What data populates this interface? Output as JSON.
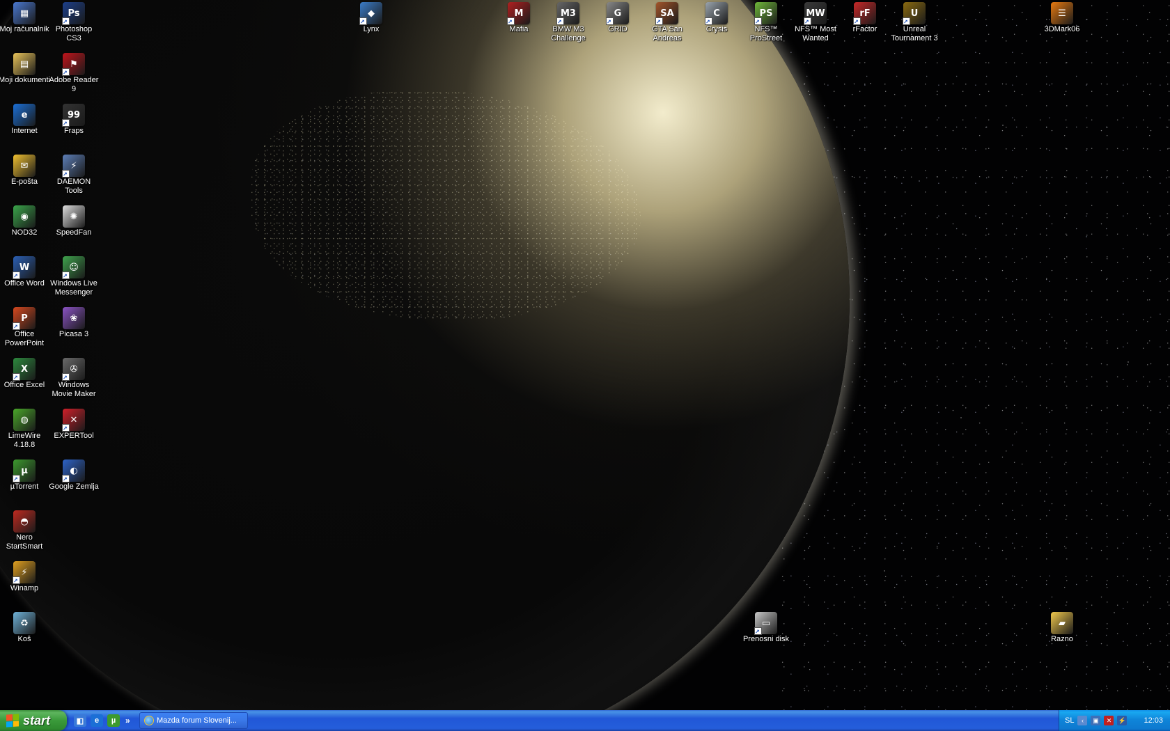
{
  "desktop": {
    "wallpaper": "earth-at-night-from-space",
    "icons": [
      {
        "label": "Moj računalnik",
        "icon": "my-computer-icon",
        "color": "#4a78d0",
        "glyph": "▦",
        "shortcut": false
      },
      {
        "label": "Photoshop CS3",
        "icon": "photoshop-icon",
        "color": "#1c3f8a",
        "glyph": "Ps",
        "shortcut": true
      },
      {
        "label": "Moji dokumenti",
        "icon": "my-documents-icon",
        "color": "#e9c45a",
        "glyph": "▤",
        "shortcut": false
      },
      {
        "label": "Adobe Reader 9",
        "icon": "adobe-reader-icon",
        "color": "#c0141b",
        "glyph": "⚑",
        "shortcut": true
      },
      {
        "label": "Internet",
        "icon": "internet-explorer-icon",
        "color": "#1b6fd6",
        "glyph": "e",
        "shortcut": false
      },
      {
        "label": "Fraps",
        "icon": "fraps-icon",
        "color": "#333333",
        "glyph": "99",
        "shortcut": true
      },
      {
        "label": "E-pošta",
        "icon": "email-icon",
        "color": "#f0c030",
        "glyph": "✉",
        "shortcut": false
      },
      {
        "label": "DAEMON Tools",
        "icon": "daemon-tools-icon",
        "color": "#5d7fb8",
        "glyph": "⚡",
        "shortcut": true
      },
      {
        "label": "NOD32",
        "icon": "nod32-icon",
        "color": "#3aa54a",
        "glyph": "◉",
        "shortcut": false
      },
      {
        "label": "SpeedFan",
        "icon": "speedfan-icon",
        "color": "#dddddd",
        "glyph": "✺",
        "shortcut": false
      },
      {
        "label": "Office Word",
        "icon": "word-icon",
        "color": "#2b5fb4",
        "glyph": "W",
        "shortcut": true
      },
      {
        "label": "Windows Live Messenger",
        "icon": "messenger-icon",
        "color": "#3fa34d",
        "glyph": "☺",
        "shortcut": true
      },
      {
        "label": "Office PowerPoint",
        "icon": "powerpoint-icon",
        "color": "#d5481f",
        "glyph": "P",
        "shortcut": true
      },
      {
        "label": "Picasa 3",
        "icon": "picasa-icon",
        "color": "#8a53c4",
        "glyph": "❀",
        "shortcut": false
      },
      {
        "label": "Office Excel",
        "icon": "excel-icon",
        "color": "#2d8a3e",
        "glyph": "X",
        "shortcut": true
      },
      {
        "label": "Windows Movie Maker",
        "icon": "movie-maker-icon",
        "color": "#6a6a6a",
        "glyph": "✇",
        "shortcut": true
      },
      {
        "label": "LimeWire 4.18.8",
        "icon": "limewire-icon",
        "color": "#4aa82a",
        "glyph": "◍",
        "shortcut": false
      },
      {
        "label": "EXPERTool",
        "icon": "expertool-icon",
        "color": "#d0202a",
        "glyph": "✕",
        "shortcut": true
      },
      {
        "label": "µTorrent",
        "icon": "utorrent-icon",
        "color": "#3c9a2e",
        "glyph": "µ",
        "shortcut": true
      },
      {
        "label": "Google Zemlja",
        "icon": "google-earth-icon",
        "color": "#2d63c8",
        "glyph": "◐",
        "shortcut": true
      },
      {
        "label": "Nero StartSmart",
        "icon": "nero-icon",
        "color": "#c02a20",
        "glyph": "◓",
        "shortcut": false
      },
      {
        "label": "Winamp",
        "icon": "winamp-icon",
        "color": "#e0a020",
        "glyph": "⚡",
        "shortcut": true
      },
      {
        "label": "Koš",
        "icon": "recycle-bin-icon",
        "color": "#6fb2d8",
        "glyph": "♻",
        "shortcut": false
      },
      {
        "label": "Lynx",
        "icon": "lynx-icon",
        "color": "#3b7cc8",
        "glyph": "◆",
        "shortcut": true
      },
      {
        "label": "Mafia",
        "icon": "mafia-icon",
        "color": "#b02020",
        "glyph": "M",
        "shortcut": true
      },
      {
        "label": "BMW M3 Challenge",
        "icon": "bmw-m3-icon",
        "color": "#666666",
        "glyph": "M3",
        "shortcut": true
      },
      {
        "label": "GRID",
        "icon": "grid-icon",
        "color": "#888888",
        "glyph": "G",
        "shortcut": true
      },
      {
        "label": "GTA San Andreas",
        "icon": "gta-san-andreas-icon",
        "color": "#a2542a",
        "glyph": "SA",
        "shortcut": true
      },
      {
        "label": "Crysis",
        "icon": "crysis-icon",
        "color": "#9aa4ad",
        "glyph": "C",
        "shortcut": true
      },
      {
        "label": "NFS™ ProStreet",
        "icon": "nfs-prostreet-icon",
        "color": "#6fb83a",
        "glyph": "PS",
        "shortcut": true
      },
      {
        "label": "NFS™ Most Wanted",
        "icon": "nfs-most-wanted-icon",
        "color": "#3a3a3a",
        "glyph": "MW",
        "shortcut": true
      },
      {
        "label": "rFactor",
        "icon": "rfactor-icon",
        "color": "#c82828",
        "glyph": "rF",
        "shortcut": true
      },
      {
        "label": "Unreal Tournament 3",
        "icon": "unreal-tournament-icon",
        "color": "#8a6a10",
        "glyph": "U",
        "shortcut": true
      },
      {
        "label": "3DMark06",
        "icon": "3dmark-icon",
        "color": "#e87a10",
        "glyph": "☰",
        "shortcut": false
      },
      {
        "label": "Prenosni disk",
        "icon": "removable-disk-icon",
        "color": "#c8c8c8",
        "glyph": "▭",
        "shortcut": true
      },
      {
        "label": "Razno",
        "icon": "folder-icon",
        "color": "#f2c94c",
        "glyph": "▰",
        "shortcut": false
      }
    ]
  },
  "taskbar": {
    "start_label": "start",
    "quick_launch": [
      {
        "icon": "show-desktop-icon",
        "color": "#3a7ad8",
        "glyph": "◧"
      },
      {
        "icon": "internet-explorer-icon",
        "color": "#1b6fd6",
        "glyph": "e"
      },
      {
        "icon": "utorrent-icon",
        "color": "#3c9a2e",
        "glyph": "µ"
      }
    ],
    "quick_launch_more": "»",
    "task_button_label": "Mazda forum Slovenij...",
    "tray": {
      "language": "SL",
      "clock": "12:03"
    }
  }
}
